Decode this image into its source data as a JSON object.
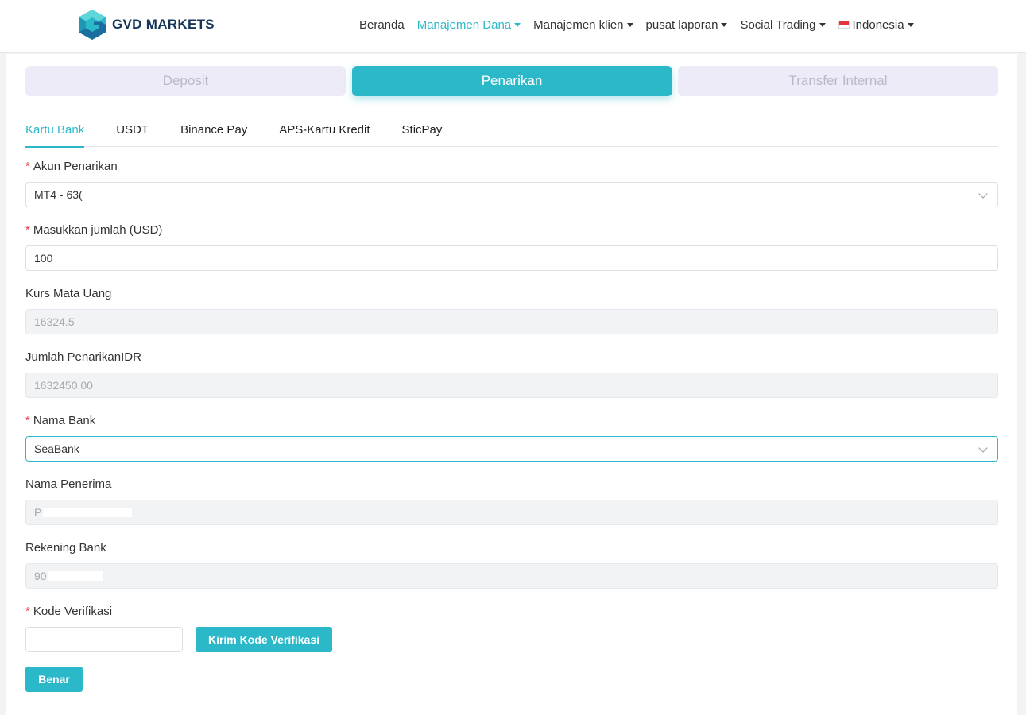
{
  "brand": {
    "name": "GVD MARKETS",
    "accent": "#2bb9c9"
  },
  "nav": {
    "home": "Beranda",
    "funds": "Manajemen Dana",
    "clients": "Manajemen klien",
    "reports": "pusat laporan",
    "social": "Social Trading",
    "language": "Indonesia"
  },
  "tabs": {
    "deposit": "Deposit",
    "withdraw": "Penarikan",
    "transfer": "Transfer Internal"
  },
  "subtabs": {
    "bank": "Kartu Bank",
    "usdt": "USDT",
    "binance": "Binance Pay",
    "aps": "APS-Kartu Kredit",
    "sticpay": "SticPay"
  },
  "form": {
    "account_label": "Akun Penarikan",
    "account_value": "MT4 - 63(",
    "amount_label": "Masukkan jumlah (USD)",
    "amount_value": "100",
    "rate_label": "Kurs Mata Uang",
    "rate_value": "16324.5",
    "idr_label": "Jumlah PenarikanIDR",
    "idr_value": "1632450.00",
    "bank_label": "Nama Bank",
    "bank_value": "SeaBank",
    "recipient_label": "Nama Penerima",
    "recipient_value": "P",
    "account_no_label": "Rekening Bank",
    "account_no_value": "90",
    "code_label": "Kode Verifikasi",
    "send_code": "Kirim Kode Verifikasi",
    "submit": "Benar"
  }
}
